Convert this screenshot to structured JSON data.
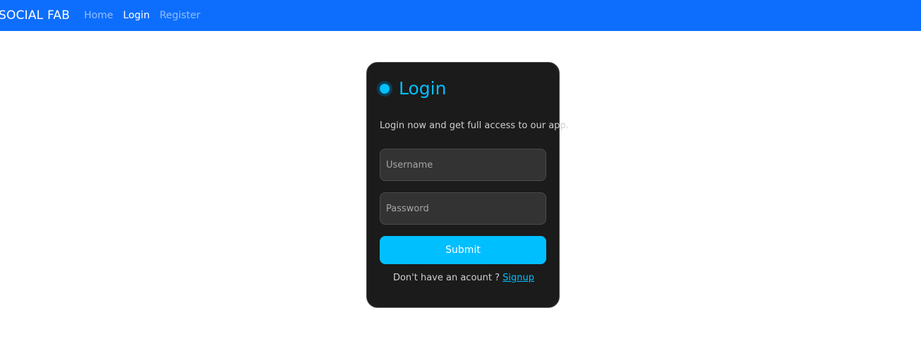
{
  "navbar": {
    "brand": "SOCIAL FAB",
    "links": [
      {
        "label": "Home",
        "active": false
      },
      {
        "label": "Login",
        "active": true
      },
      {
        "label": "Register",
        "active": false
      }
    ]
  },
  "login_card": {
    "title": "Login",
    "subtitle": "Login now and get full access to our app.",
    "username_placeholder": "Username",
    "password_placeholder": "Password",
    "submit_label": "Submit",
    "signup_prompt": "Don't have an acount ?",
    "signup_link": "Signup"
  },
  "colors": {
    "navbar_bg": "#0d6efd",
    "card_bg": "#1b1b1b",
    "accent": "#00bfff",
    "input_bg": "#333333"
  },
  "icons": {
    "title_dot": "status-dot-icon"
  }
}
